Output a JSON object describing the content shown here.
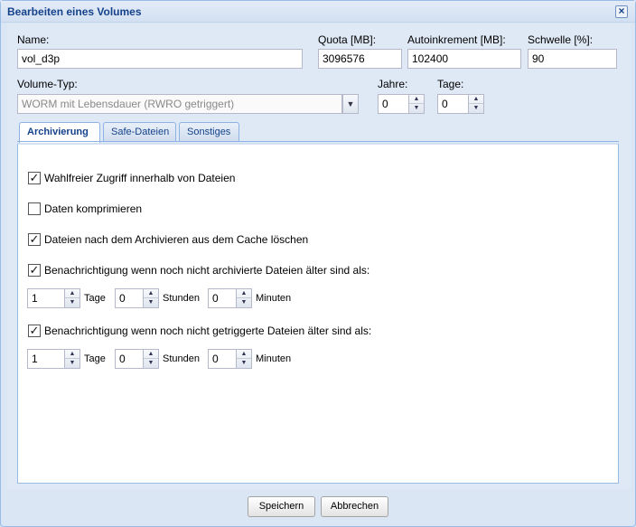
{
  "window": {
    "title": "Bearbeiten eines Volumes",
    "close_glyph": "×"
  },
  "form": {
    "name": {
      "label": "Name:",
      "value": "vol_d3p"
    },
    "quota": {
      "label": "Quota [MB]:",
      "value": "3096576"
    },
    "autoinkrement": {
      "label": "Autoinkrement [MB]:",
      "value": "102400"
    },
    "schwelle": {
      "label": "Schwelle [%]:",
      "value": "90"
    },
    "volume_typ": {
      "label": "Volume-Typ:",
      "value": "WORM mit Lebensdauer (RWRO getriggert)"
    },
    "jahre": {
      "label": "Jahre:",
      "value": "0"
    },
    "tage": {
      "label": "Tage:",
      "value": "0"
    }
  },
  "tabs": [
    {
      "label": "Archivierung",
      "active": true
    },
    {
      "label": "Safe-Dateien",
      "active": false
    },
    {
      "label": "Sonstiges",
      "active": false
    }
  ],
  "archivierung": {
    "options": [
      {
        "label": "Wahlfreier Zugriff innerhalb von Dateien",
        "checked": true
      },
      {
        "label": "Daten komprimieren",
        "checked": false
      },
      {
        "label": "Dateien nach dem Archivieren aus dem Cache löschen",
        "checked": true
      },
      {
        "label": "Benachrichtigung wenn noch nicht archivierte Dateien älter sind als:",
        "checked": true
      },
      {
        "label": "Benachrichtigung wenn noch nicht getriggerte Dateien älter sind als:",
        "checked": true
      }
    ],
    "archived_age": {
      "tage": "1",
      "stunden": "0",
      "minuten": "0"
    },
    "triggered_age": {
      "tage": "1",
      "stunden": "0",
      "minuten": "0"
    },
    "units": {
      "tage": "Tage",
      "stunden": "Stunden",
      "minuten": "Minuten"
    }
  },
  "glyphs": {
    "check": "✓",
    "spin_up": "▲",
    "spin_down": "▼",
    "combo": "▼"
  },
  "footer": {
    "save_label": "Speichern",
    "cancel_label": "Abbrechen"
  }
}
